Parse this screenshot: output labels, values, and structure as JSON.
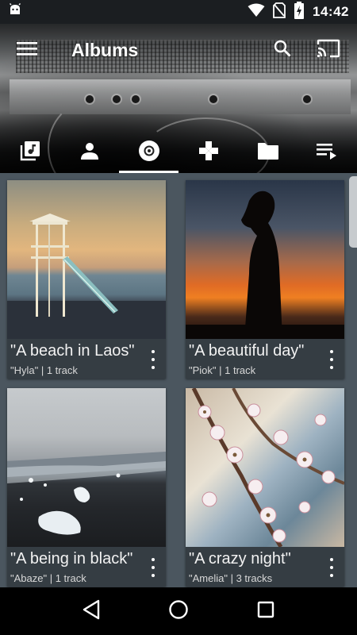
{
  "status_bar": {
    "time": "14:42",
    "icons": [
      "android-notification-icon",
      "wifi-icon",
      "no-sim-icon",
      "battery-charging-icon"
    ]
  },
  "toolbar": {
    "title": "Albums",
    "menu_icon": "hamburger-menu-icon",
    "search_icon": "search-icon",
    "cast_icon": "cast-icon"
  },
  "tabs": [
    {
      "icon": "music-library-icon",
      "active": false
    },
    {
      "icon": "person-icon",
      "active": false
    },
    {
      "icon": "album-disc-icon",
      "active": true
    },
    {
      "icon": "genres-icon",
      "active": false
    },
    {
      "icon": "folder-icon",
      "active": false
    },
    {
      "icon": "playlist-icon",
      "active": false
    }
  ],
  "albums": [
    {
      "title": "\"A beach in Laos\"",
      "subtitle": "\"Hyla\" | 1 track"
    },
    {
      "title": "\"A beautiful day\"",
      "subtitle": "\"Piok\" | 1 track"
    },
    {
      "title": "\"A being in black\"",
      "subtitle": "\"Abaze\" | 1 track"
    },
    {
      "title": "\"A crazy night\"",
      "subtitle": "\"Amelia\" | 3 tracks"
    }
  ],
  "nav_bar": {
    "buttons": [
      "back-icon",
      "home-icon",
      "recents-icon"
    ]
  },
  "colors": {
    "content_background": "#4b565f",
    "card_info_background": "#353d43",
    "active_tab_indicator": "#ffffff"
  }
}
